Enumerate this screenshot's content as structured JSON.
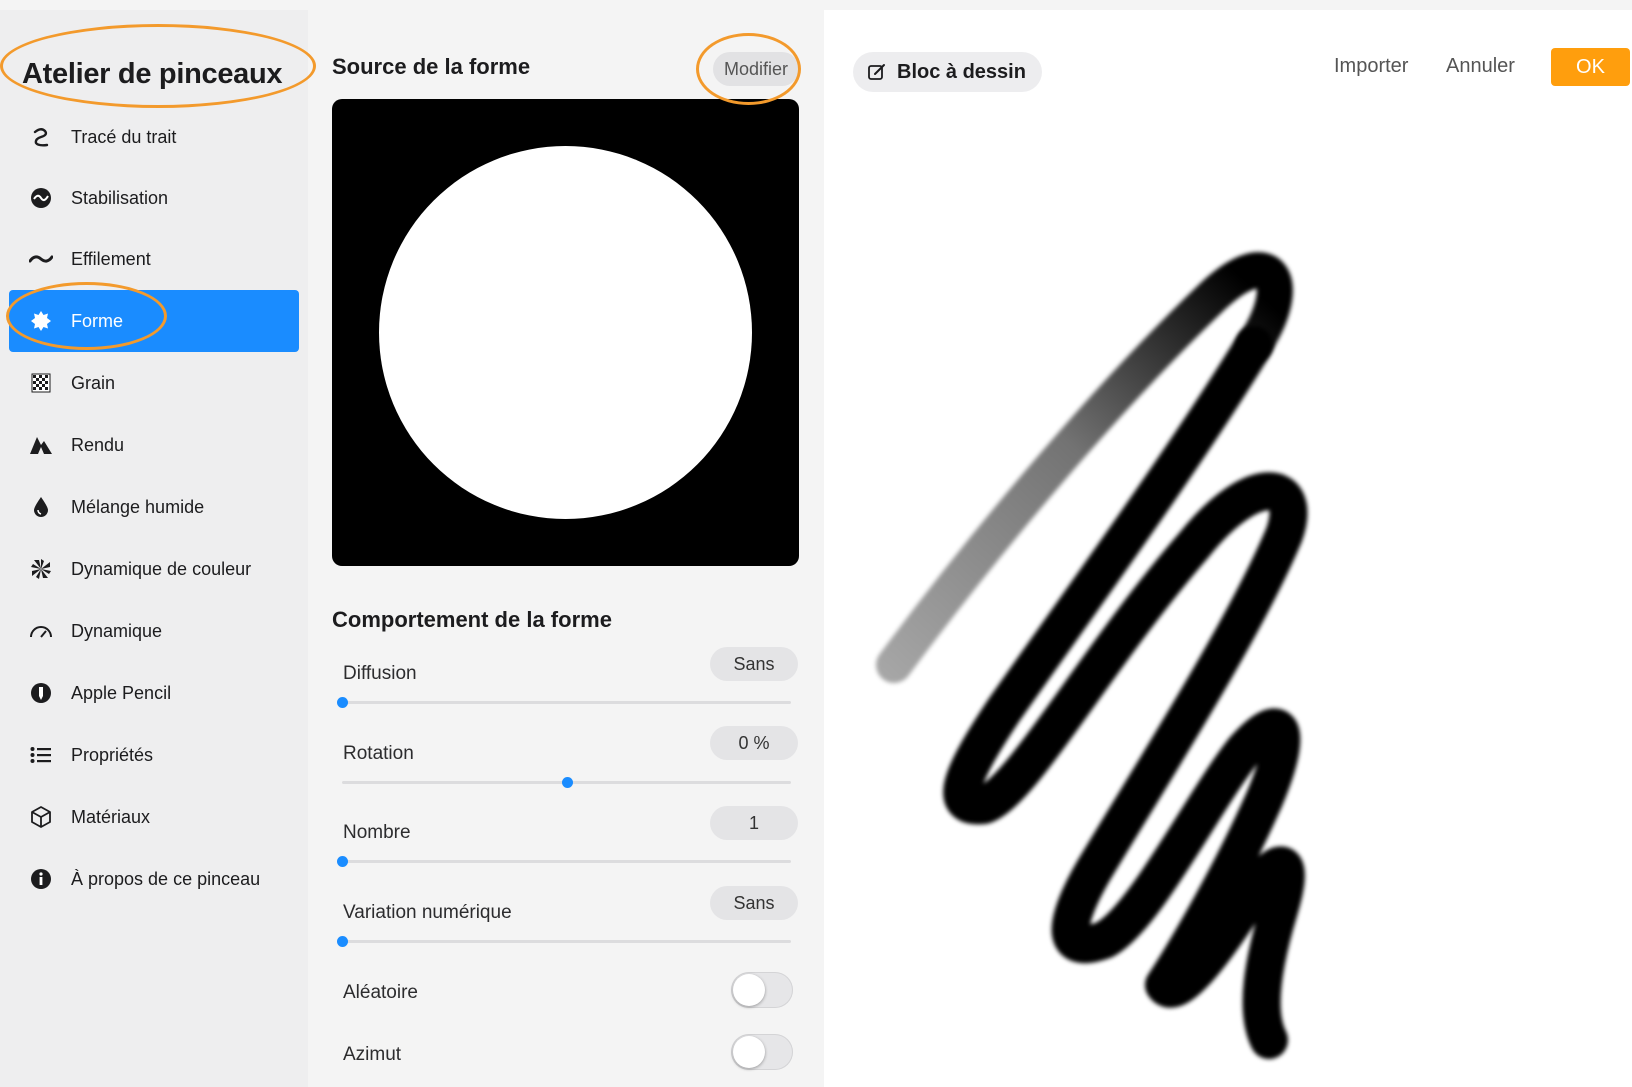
{
  "sidebar": {
    "title": "Atelier de pinceaux",
    "items": [
      {
        "label": "Tracé du trait",
        "icon": "stroke-path-icon"
      },
      {
        "label": "Stabilisation",
        "icon": "stabilization-icon"
      },
      {
        "label": "Effilement",
        "icon": "taper-icon"
      },
      {
        "label": "Forme",
        "icon": "shape-icon",
        "active": true
      },
      {
        "label": "Grain",
        "icon": "grain-icon"
      },
      {
        "label": "Rendu",
        "icon": "rendering-icon"
      },
      {
        "label": "Mélange humide",
        "icon": "wet-mix-icon"
      },
      {
        "label": "Dynamique de couleur",
        "icon": "color-dynamics-icon"
      },
      {
        "label": "Dynamique",
        "icon": "dynamics-icon"
      },
      {
        "label": "Apple Pencil",
        "icon": "apple-pencil-icon"
      },
      {
        "label": "Propriétés",
        "icon": "properties-icon"
      },
      {
        "label": "Matériaux",
        "icon": "materials-icon"
      },
      {
        "label": "À propos de ce pinceau",
        "icon": "info-icon"
      }
    ]
  },
  "settings": {
    "shape_source_title": "Source de la forme",
    "edit_label": "Modifier",
    "behavior_title": "Comportement de la forme",
    "params": [
      {
        "label": "Diffusion",
        "value": "Sans",
        "level": 0
      },
      {
        "label": "Rotation",
        "value": "0 %",
        "level": 0.5
      },
      {
        "label": "Nombre",
        "value": "1",
        "level": 0
      },
      {
        "label": "Variation numérique",
        "value": "Sans",
        "level": 0
      }
    ],
    "toggles": [
      {
        "label": "Aléatoire",
        "on": false
      },
      {
        "label": "Azimut",
        "on": false
      }
    ]
  },
  "canvas": {
    "drawing_pad_label": "Bloc à dessin",
    "import_label": "Importer",
    "cancel_label": "Annuler",
    "ok_label": "OK"
  },
  "colors": {
    "accent_blue": "#1a8cff",
    "ok_orange": "#ff9e0d",
    "annotation_orange": "#f39a2c"
  }
}
